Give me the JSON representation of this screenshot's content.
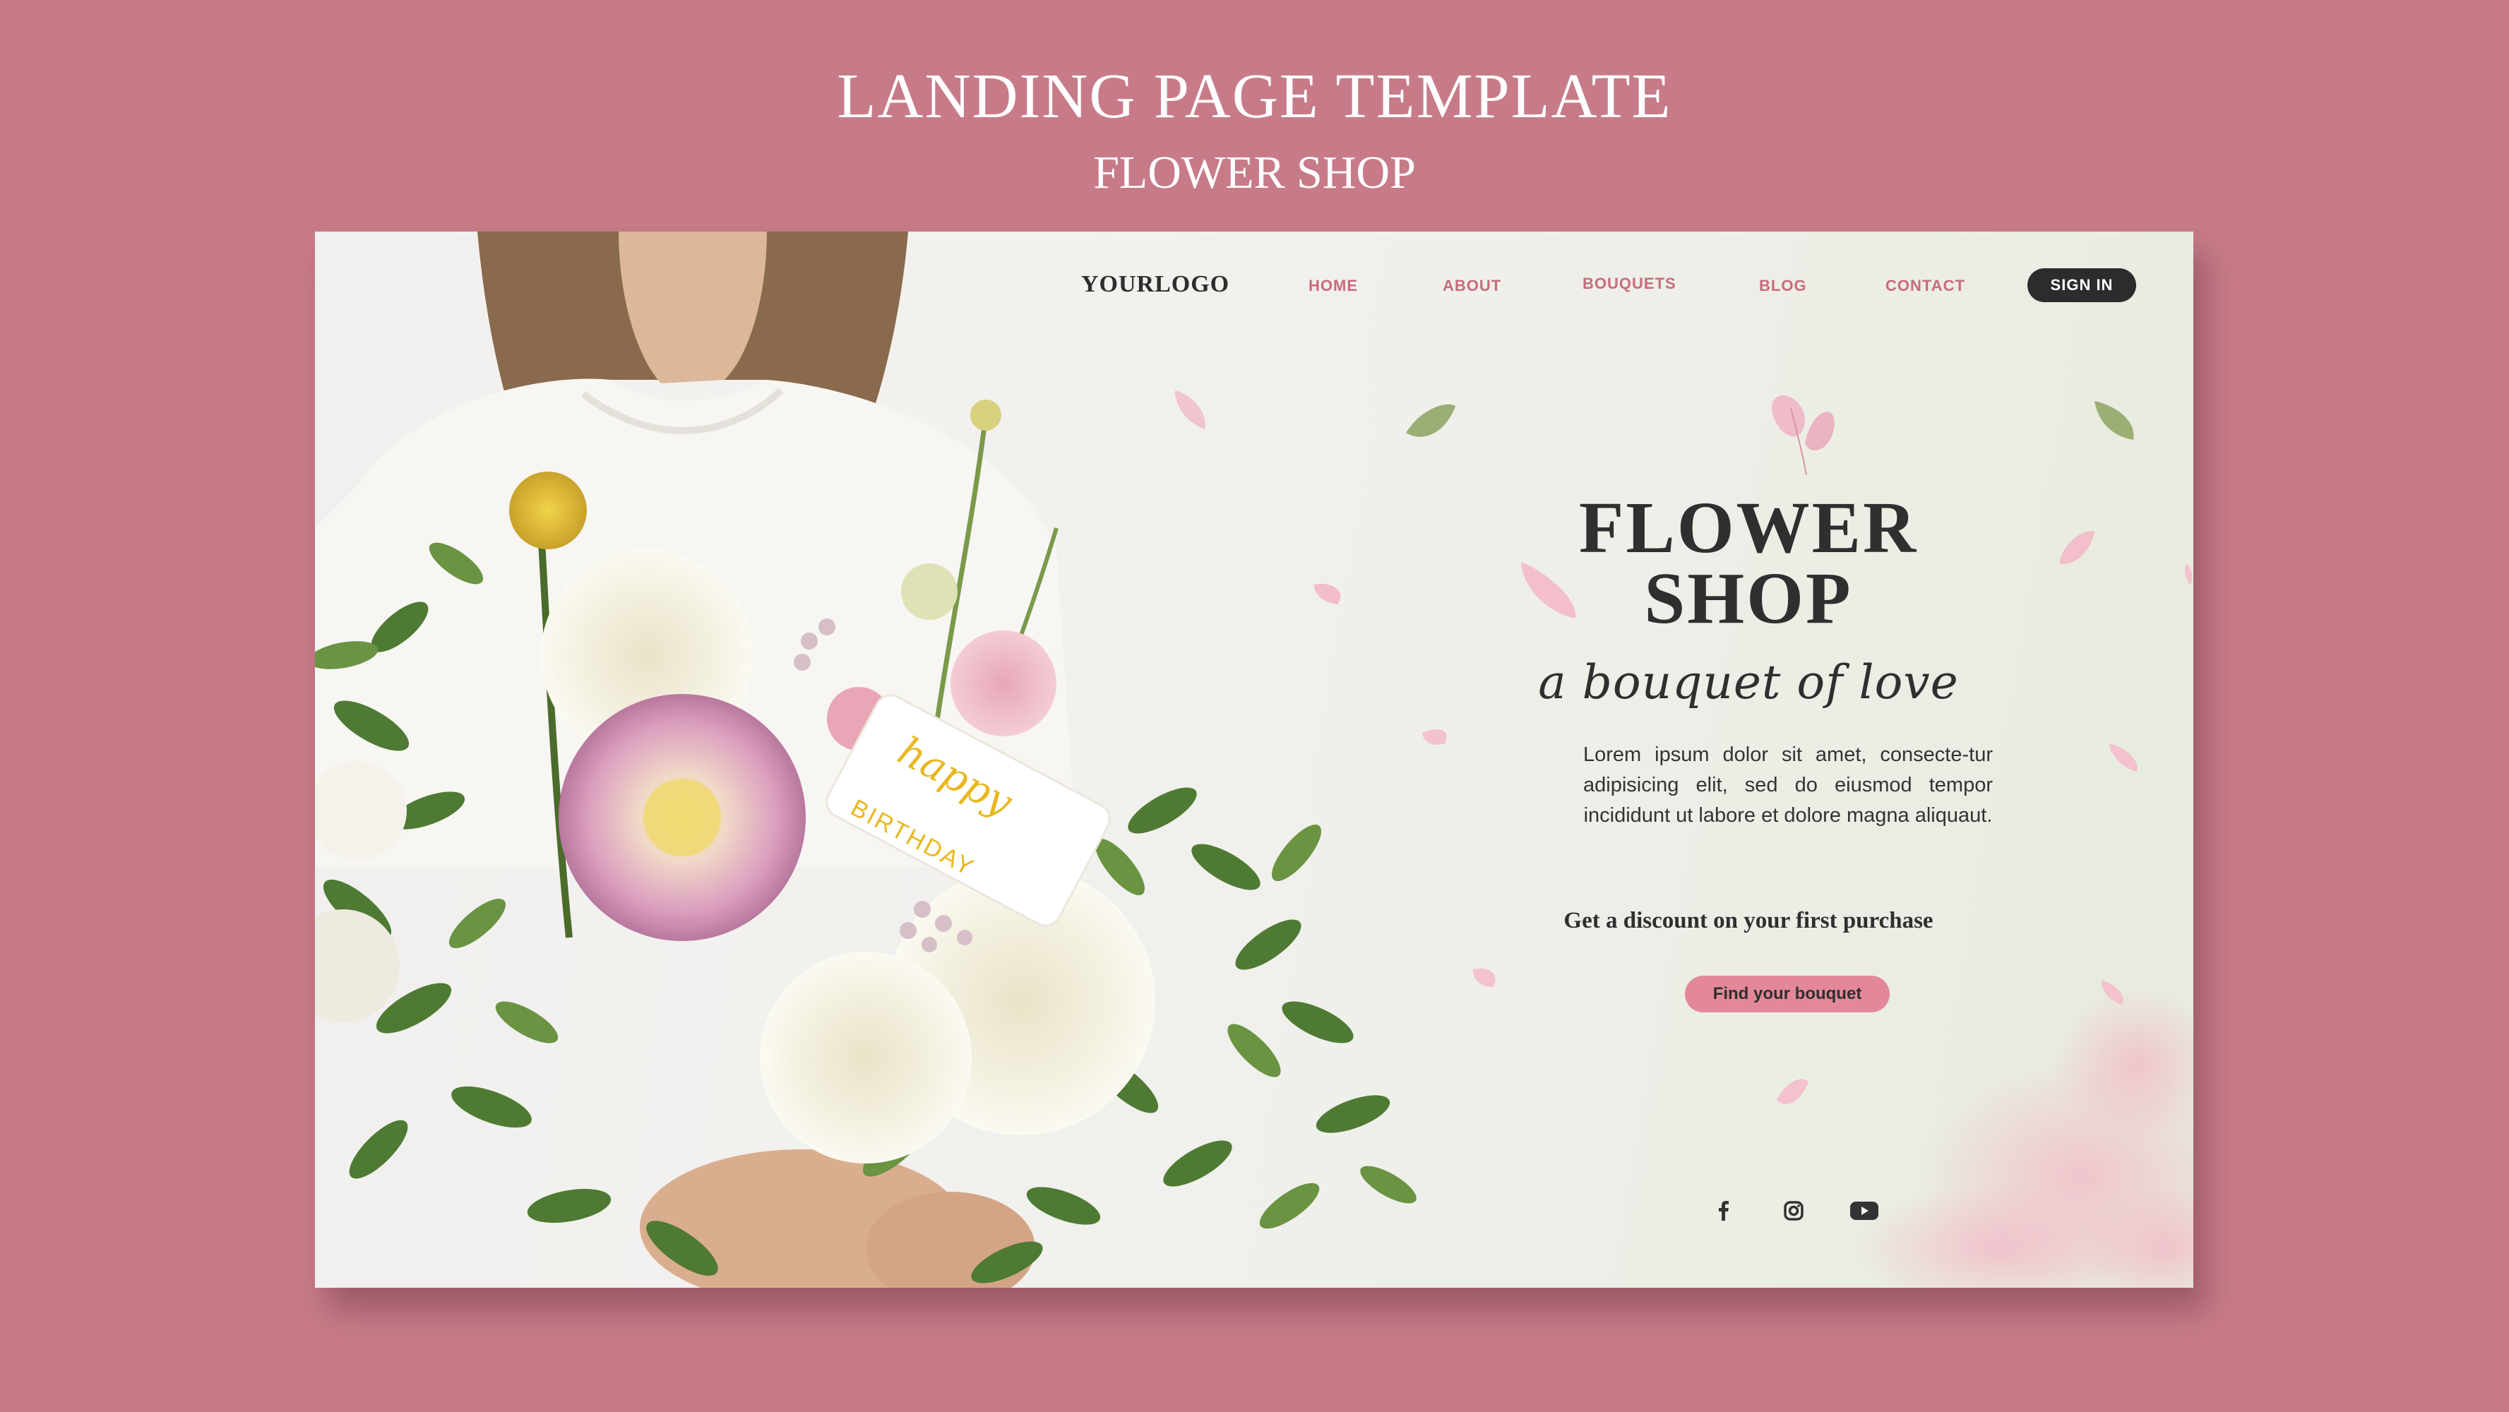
{
  "page": {
    "title": "LANDING PAGE TEMPLATE",
    "subtitle": "FLOWER SHOP"
  },
  "nav": {
    "logo": "YOURLOGO",
    "links": [
      "HOME",
      "ABOUT",
      "BOUQUETS",
      "BLOG",
      "CONTACT"
    ],
    "signin": "SIGN IN"
  },
  "hero": {
    "title_line1": "FLOWER",
    "title_line2": "SHOP",
    "tagline": "a bouquet of love",
    "body": "Lorem ipsum dolor sit amet, consecte-tur adipisicing elit, sed do eiusmod tempor incididunt ut labore et dolore magna aliquaut.",
    "discount": "Get a discount on your first purchase",
    "cta": "Find your bouquet",
    "card_text_line1": "happy",
    "card_text_line2": "BIRTHDAY"
  },
  "social": {
    "icons": [
      "facebook-icon",
      "instagram-icon",
      "youtube-icon"
    ]
  },
  "colors": {
    "background": "#c77b88",
    "accent_pink": "#e3889a",
    "nav_link": "#c96a7d",
    "dark": "#2c2c2c",
    "card_text": "#e8b820"
  }
}
